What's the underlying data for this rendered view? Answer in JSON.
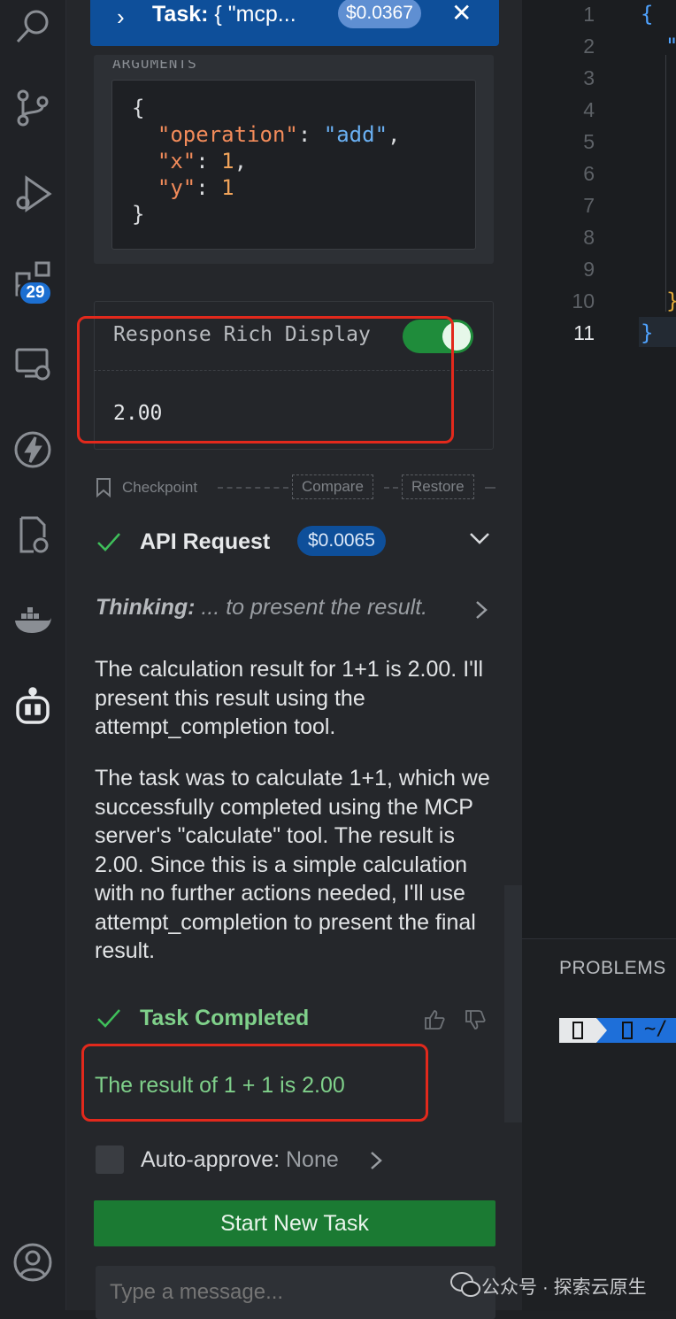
{
  "colors": {
    "accent_blue": "#0e4f9a",
    "success_green": "#7fd08a",
    "button_green": "#1b7a33",
    "highlight_red": "#e2291c"
  },
  "activity_bar": {
    "extensions_badge": "29"
  },
  "task_header": {
    "label_prefix": "Task:",
    "label_text": " { \"mcp...",
    "cost": "$0.0367"
  },
  "arguments": {
    "section_title": "ARGUMENTS",
    "code_lines": [
      {
        "brace": "{"
      },
      {
        "key": "\"operation\"",
        "sep": ": ",
        "value": "\"add\"",
        "end": ","
      },
      {
        "key": "\"x\"",
        "sep": ": ",
        "value": "1",
        "end": ","
      },
      {
        "key": "\"y\"",
        "sep": ": ",
        "value": "1",
        "end": ""
      },
      {
        "brace": "}"
      }
    ]
  },
  "response": {
    "label": "Response",
    "toggle_label": "Rich Display",
    "toggle_on": true,
    "value": "2.00"
  },
  "checkpoint": {
    "label": "Checkpoint",
    "compare": "Compare",
    "restore": "Restore"
  },
  "api_request": {
    "title": "API Request",
    "cost": "$0.0065"
  },
  "thinking": {
    "label": "Thinking:",
    "text": " ... to present the result."
  },
  "messages": {
    "p1": "The calculation result for 1+1 is 2.00. I'll present this result using the attempt_completion tool.",
    "p2": "The task was to calculate 1+1, which we successfully completed using the MCP server's \"calculate\" tool. The result is 2.00. Since this is a simple calculation with no further actions needed, I'll use attempt_completion to present the final result."
  },
  "task_completed": {
    "title": "Task Completed",
    "result": "The result of 1 + 1 is 2.00"
  },
  "auto_approve": {
    "label": "Auto-approve:",
    "value": "None"
  },
  "start_button": "Start New Task",
  "message_input": {
    "placeholder": "Type a message..."
  },
  "editor": {
    "line_numbers": [
      "1",
      "2",
      "3",
      "4",
      "5",
      "6",
      "7",
      "8",
      "9",
      "10",
      "11"
    ],
    "active_line": "11",
    "line1_text": "{",
    "line2_text": "\"",
    "line10_text": "}",
    "line11_text": "}"
  },
  "bottom_panel": {
    "problems_tab": "PROBLEMS",
    "terminal_path": "~/"
  },
  "watermark": {
    "text": "公众号 · 探索云原生"
  }
}
